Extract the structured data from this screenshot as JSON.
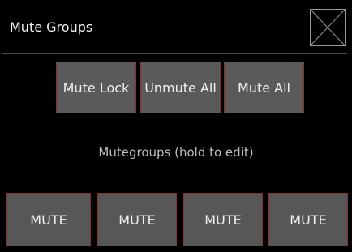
{
  "window": {
    "title": "Mute Groups",
    "close_icon": "close-x-icon"
  },
  "controls": {
    "mute_lock_label": "Mute Lock",
    "unmute_all_label": "Unmute All",
    "mute_all_label": "Mute All"
  },
  "caption": "Mutegroups (hold to edit)",
  "mute_groups": [
    {
      "label": "MUTE"
    },
    {
      "label": "MUTE"
    },
    {
      "label": "MUTE"
    },
    {
      "label": "MUTE"
    }
  ],
  "colors": {
    "background": "#000000",
    "button": "#5a5a5a",
    "button_border": "#8a3232",
    "text": "#f0f0f0",
    "caption_text": "#bdbdbd"
  }
}
